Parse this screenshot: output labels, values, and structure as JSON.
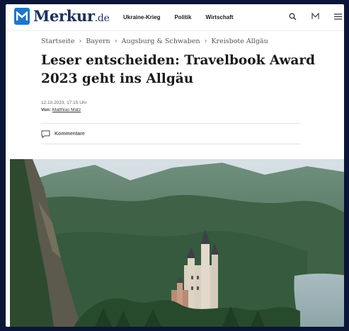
{
  "header": {
    "logo_text": "Merkur",
    "logo_tld": ".de",
    "nav": [
      "Ukraine-Krieg",
      "Politik",
      "Wirtschaft"
    ]
  },
  "breadcrumb": [
    "Startseite",
    "Bayern",
    "Augsburg & Schwaben",
    "Kreisbote Allgäu"
  ],
  "article": {
    "title": "Leser entscheiden: Travelbook Award 2023 geht ins Allgäu",
    "date": "12.10.2023, 17:15 Uhr",
    "author_prefix": "Von:",
    "author": "Matthias Matz",
    "comments_label": "Kommentare"
  },
  "colors": {
    "brand_blue": "#1e78c8",
    "logo_text": "#1b2f5a",
    "outer_background": "#0b1538"
  },
  "icons": [
    "merkur-logo-icon",
    "search-icon",
    "m-icon",
    "menu-icon",
    "comment-icon"
  ]
}
